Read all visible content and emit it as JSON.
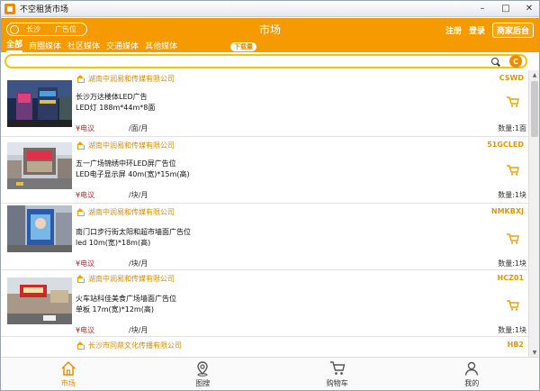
{
  "window": {
    "title": "不空租赁市场",
    "controls": {
      "minimize": "–",
      "maximize": "□",
      "close": "✕"
    }
  },
  "header": {
    "city": "长沙",
    "category": "广告位",
    "title": "市场",
    "register": "注册",
    "login": "登录",
    "admin_button": "商家后台"
  },
  "tabs": [
    {
      "label": "全部",
      "active": true
    },
    {
      "label": "商圈媒体",
      "active": false
    },
    {
      "label": "社区媒体",
      "active": false
    },
    {
      "label": "交通媒体",
      "active": false
    },
    {
      "label": "其他媒体",
      "active": false
    }
  ],
  "new_badge": "下载量",
  "search": {
    "placeholder": "",
    "logo_letter": "C"
  },
  "listings": [
    {
      "company": "湖南中润易和传媒有限公司",
      "code": "CSWD",
      "title": "长沙万达楼体LED广告",
      "spec": "LED灯 188m*44m*8面",
      "price": "¥电议",
      "unit": "/面/月",
      "qty": "数量:1面"
    },
    {
      "company": "湖南中润易和传媒有限公司",
      "code": "51GCLED",
      "title": "五一广场锦绣中环LED屏广告位",
      "spec": "LED电子显示屏 40m(宽)*15m(高)",
      "price": "¥电议",
      "unit": "/块/月",
      "qty": "数量:1块"
    },
    {
      "company": "湖南中润易和传媒有限公司",
      "code": "NMKBXJ",
      "title": "南门口步行街太阳和超市墙面广告位",
      "spec": "led 10m(宽)*18m(高)",
      "price": "¥电议",
      "unit": "/块/月",
      "qty": "数量:1块"
    },
    {
      "company": "湖南中润易和传媒有限公司",
      "code": "HCZ01",
      "title": "火车站科佳美食广场墙面广告位",
      "spec": "单板 17m(宽)*12m(高)",
      "price": "¥电议",
      "unit": "/块/月",
      "qty": "数量:1块"
    },
    {
      "company": "长沙市同鼎文化传播有限公司",
      "code": "HB2",
      "title": "",
      "spec": "",
      "price": "",
      "unit": "",
      "qty": ""
    }
  ],
  "bottom_nav": [
    {
      "label": "市场",
      "icon": "home-icon",
      "active": true
    },
    {
      "label": "图搜",
      "icon": "map-pin-icon",
      "active": false
    },
    {
      "label": "购物车",
      "icon": "cart-icon",
      "active": false
    },
    {
      "label": "我的",
      "icon": "user-icon",
      "active": false
    }
  ],
  "colors": {
    "brand_orange": "#f59a00",
    "search_border": "#f5c400",
    "price_red": "#d61c1c"
  }
}
